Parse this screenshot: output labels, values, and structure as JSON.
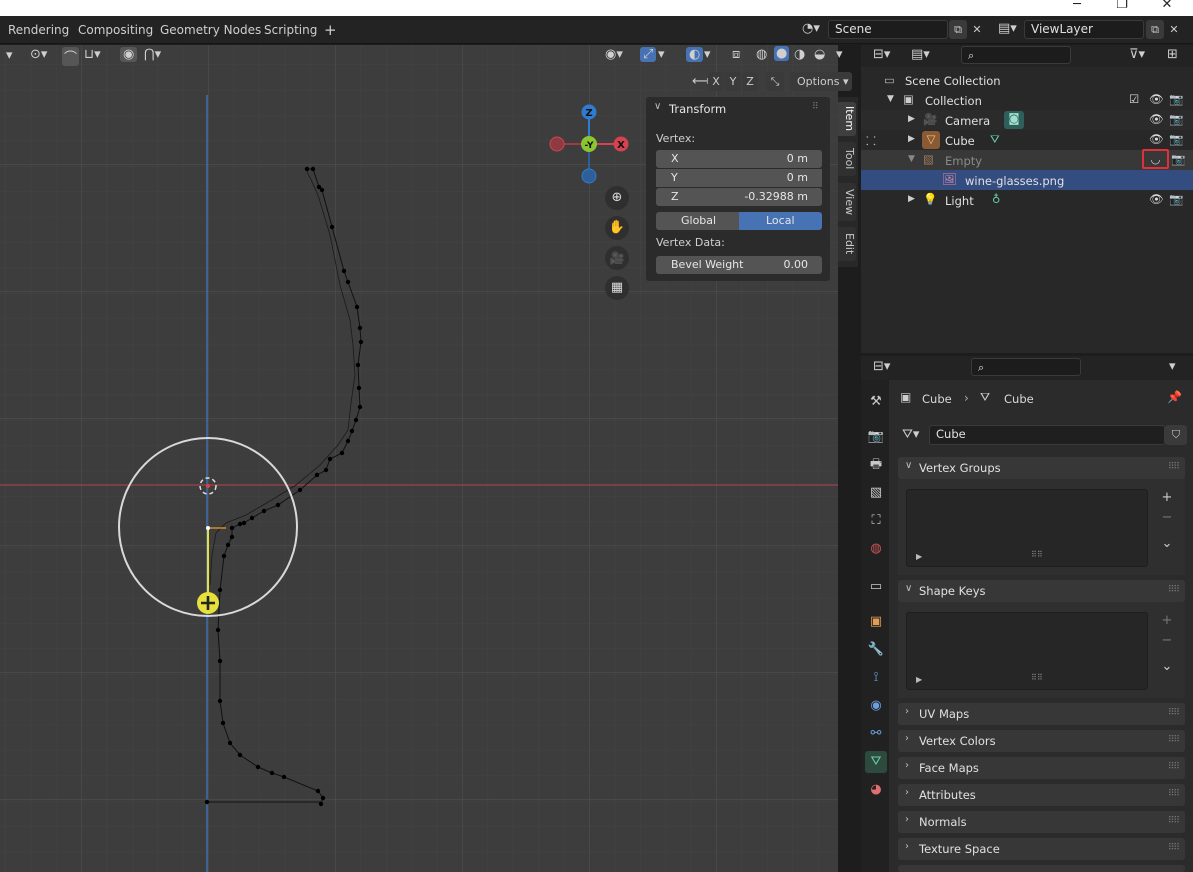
{
  "window": {
    "minimize": "─",
    "maximize": "❐",
    "close": "✕"
  },
  "workspace_tabs": [
    "Rendering",
    "Compositing",
    "Geometry Nodes",
    "Scripting",
    "+"
  ],
  "scene": {
    "name": "Scene",
    "view_layer": "ViewLayer"
  },
  "viewport": {
    "axis_buttons": [
      "X",
      "Y",
      "Z"
    ],
    "options_label": "Options",
    "gizmo_labels": {
      "z": "Z",
      "y": "-Y",
      "x": "X"
    },
    "side_tabs": [
      "Item",
      "Tool",
      "View",
      "Edit"
    ]
  },
  "transform_panel": {
    "title": "Transform",
    "vertex_label": "Vertex:",
    "fields": [
      {
        "label": "X",
        "value": "0 m"
      },
      {
        "label": "Y",
        "value": "0 m"
      },
      {
        "label": "Z",
        "value": "-0.32988 m"
      }
    ],
    "space_options": [
      "Global",
      "Local"
    ],
    "space_selected": "Local",
    "vertex_data_label": "Vertex Data:",
    "bevel_label": "Bevel Weight",
    "bevel_value": "0.00"
  },
  "outliner": {
    "root": "Scene Collection",
    "rows": [
      {
        "label": "Collection",
        "indent": 1
      },
      {
        "label": "Camera",
        "indent": 2
      },
      {
        "label": "Cube",
        "indent": 2
      },
      {
        "label": "Empty",
        "indent": 2
      },
      {
        "label": "wine-glasses.png",
        "indent": 3
      },
      {
        "label": "Light",
        "indent": 2
      }
    ]
  },
  "properties": {
    "breadcrumb": [
      "Cube",
      "Cube"
    ],
    "mesh_name": "Cube",
    "sections": [
      {
        "label": "Vertex Groups",
        "expanded": true
      },
      {
        "label": "Shape Keys",
        "expanded": true
      },
      {
        "label": "UV Maps",
        "expanded": false
      },
      {
        "label": "Vertex Colors",
        "expanded": false
      },
      {
        "label": "Face Maps",
        "expanded": false
      },
      {
        "label": "Attributes",
        "expanded": false
      },
      {
        "label": "Normals",
        "expanded": false
      },
      {
        "label": "Texture Space",
        "expanded": false
      }
    ]
  },
  "colors": {
    "accent_blue": "#4772b3",
    "selected_row": "#334d80",
    "axis_x": "#d4434f",
    "axis_y": "#8bc531",
    "axis_z": "#2f7bd0",
    "cursor_yellow": "#e8e03a",
    "highlight_red": "#e0303a"
  }
}
